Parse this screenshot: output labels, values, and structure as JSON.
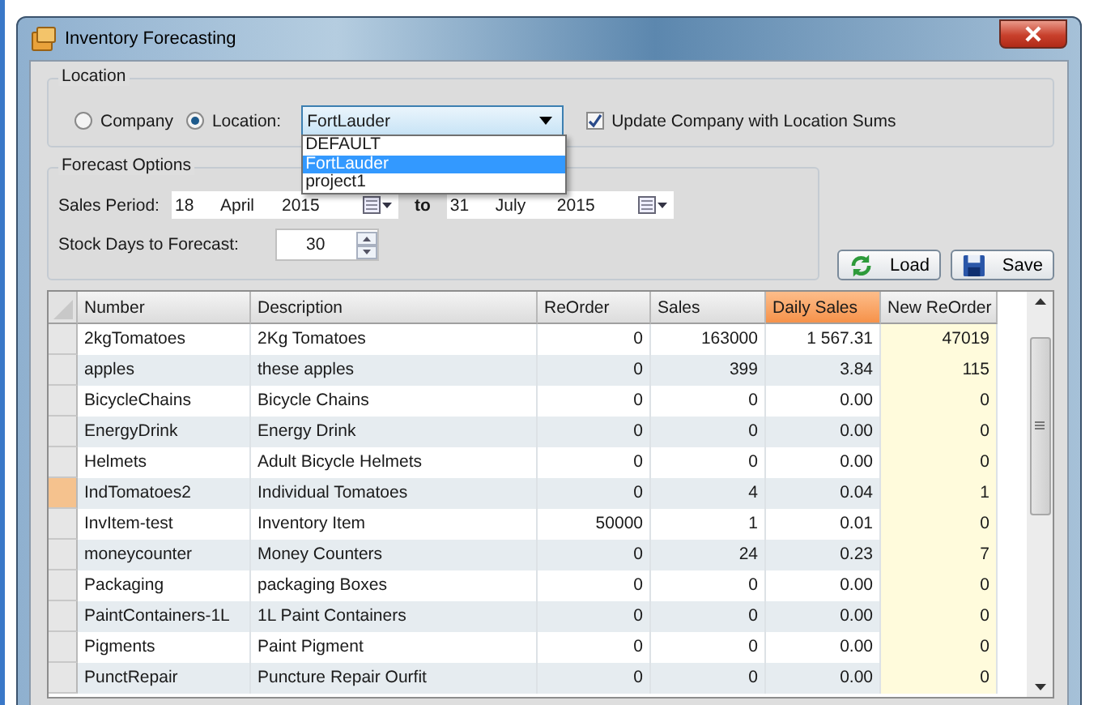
{
  "window": {
    "title": "Inventory Forecasting"
  },
  "location": {
    "title": "Location",
    "options": [
      {
        "label": "Company",
        "selected": false
      },
      {
        "label": "Location:",
        "selected": true
      }
    ],
    "dropdown": {
      "value": "FortLauder",
      "expanded": true,
      "items": [
        {
          "label": "DEFAULT",
          "selected": false
        },
        {
          "label": "FortLauder",
          "selected": true
        },
        {
          "label": "project1",
          "selected": false
        }
      ]
    },
    "update_checkbox": {
      "label": "Update Company with Location Sums",
      "checked": true
    }
  },
  "forecast_options": {
    "title": "Forecast Options",
    "sales_period_label": "Sales Period:",
    "from": {
      "day": "18",
      "month": "April",
      "year": "2015"
    },
    "to_label": "to",
    "to": {
      "day": "31",
      "month": "July",
      "year": "2015"
    },
    "stock_days_label": "Stock Days to Forecast:",
    "stock_days": "30"
  },
  "buttons": [
    {
      "label": "Load",
      "kind": "load"
    },
    {
      "label": "Save",
      "kind": "save"
    }
  ],
  "table": {
    "columns": [
      {
        "label": "Number",
        "selected": false
      },
      {
        "label": "Description",
        "selected": false
      },
      {
        "label": "ReOrder",
        "selected": false
      },
      {
        "label": "Sales",
        "selected": false
      },
      {
        "label": "Daily Sales",
        "selected": true
      },
      {
        "label": "New ReOrder",
        "selected": false
      }
    ],
    "rows": [
      {
        "selected": false,
        "cells": [
          "2kgTomatoes",
          "2Kg Tomatoes",
          "0",
          "163000",
          "1 567.31",
          "47019"
        ]
      },
      {
        "selected": false,
        "cells": [
          "apples",
          "these apples",
          "0",
          "399",
          "3.84",
          "115"
        ]
      },
      {
        "selected": false,
        "cells": [
          "BicycleChains",
          "Bicycle Chains",
          "0",
          "0",
          "0.00",
          "0"
        ]
      },
      {
        "selected": false,
        "cells": [
          "EnergyDrink",
          "Energy Drink",
          "0",
          "0",
          "0.00",
          "0"
        ]
      },
      {
        "selected": false,
        "cells": [
          "Helmets",
          "Adult Bicycle Helmets",
          "0",
          "0",
          "0.00",
          "0"
        ]
      },
      {
        "selected": true,
        "cells": [
          "IndTomatoes2",
          "Individual Tomatoes",
          "0",
          "4",
          "0.04",
          "1"
        ]
      },
      {
        "selected": false,
        "cells": [
          "InvItem-test",
          "Inventory Item",
          "50000",
          "1",
          "0.01",
          "0"
        ]
      },
      {
        "selected": false,
        "cells": [
          "moneycounter",
          "Money Counters",
          "0",
          "24",
          "0.23",
          "7"
        ]
      },
      {
        "selected": false,
        "cells": [
          "Packaging",
          "packaging Boxes",
          "0",
          "0",
          "0.00",
          "0"
        ]
      },
      {
        "selected": false,
        "cells": [
          "PaintContainers-1L",
          "1L Paint Containers",
          "0",
          "0",
          "0.00",
          "0"
        ]
      },
      {
        "selected": false,
        "cells": [
          "Pigments",
          "Paint Pigment",
          "0",
          "0",
          "0.00",
          "0"
        ]
      },
      {
        "selected": false,
        "cells": [
          "PunctRepair",
          "Puncture Repair Ourfit",
          "0",
          "0",
          "0.00",
          "0"
        ]
      }
    ]
  }
}
